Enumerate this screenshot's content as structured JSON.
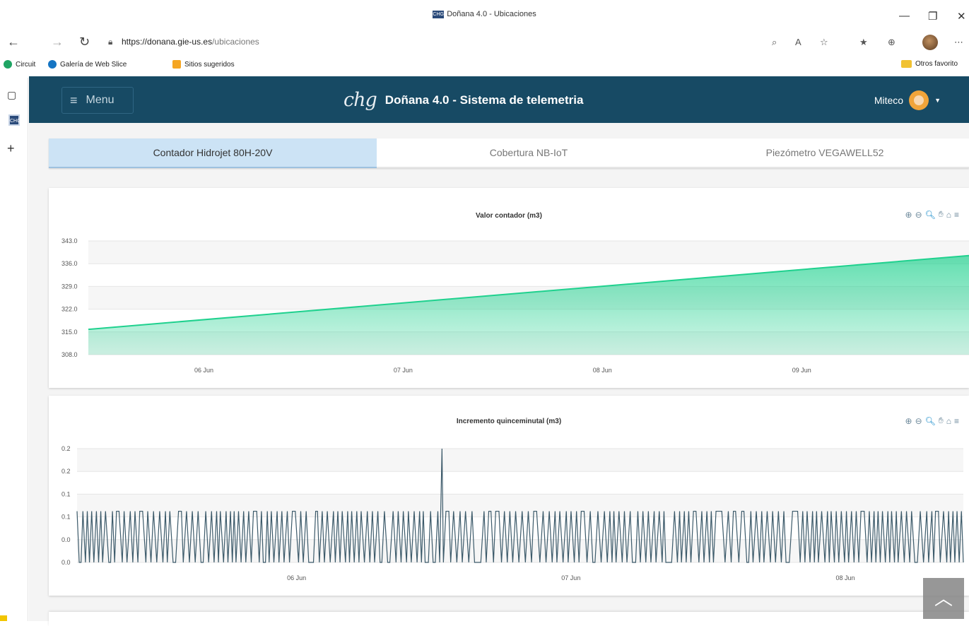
{
  "window": {
    "title": "Doñana 4.0 - Ubicaciones",
    "favicon_text": "CHG",
    "min": "—",
    "max": "❐",
    "close": "✕"
  },
  "browser": {
    "url_host": "https://donana.gie-us.es",
    "url_path": "/ubicaciones",
    "bookmarks": [
      {
        "label": "Circuit",
        "color": "#1fa463"
      },
      {
        "label": "Galería de Web Slice",
        "color": "#1575c3"
      },
      {
        "label": "Sitios sugeridos",
        "color": "#f5a623"
      }
    ],
    "other_favorites": "Otros favorito"
  },
  "rail": {
    "chg_text": "CHG",
    "add": "+"
  },
  "header": {
    "menu_label": "Menu",
    "logo_text": "chg",
    "title": "Doñana 4.0 - Sistema de telemetria",
    "user": "Miteco"
  },
  "tabs": [
    {
      "label": "Contador Hidrojet 80H-20V",
      "active": true
    },
    {
      "label": "Cobertura NB-IoT",
      "active": false
    },
    {
      "label": "Piezómetro VEGAWELL52",
      "active": false
    }
  ],
  "chart_data": [
    {
      "type": "area",
      "title": "Valor contador (m3)",
      "ylim": [
        308.0,
        343.0
      ],
      "yticks": [
        "343.0",
        "336.0",
        "329.0",
        "322.0",
        "315.0",
        "308.0"
      ],
      "xticks": [
        {
          "label": "06 Jun",
          "day": 6
        },
        {
          "label": "07 Jun",
          "day": 7
        },
        {
          "label": "08 Jun",
          "day": 8
        },
        {
          "label": "09 Jun",
          "day": 9
        }
      ],
      "x_start_day": 5.42,
      "x_end_day": 9.84,
      "series": [
        {
          "points": [
            [
              5.42,
              315.8
            ],
            [
              9.84,
              338.5
            ]
          ]
        }
      ],
      "color": "#1fd18e",
      "grid": true
    },
    {
      "type": "line",
      "title": "Incremento quinceminutal (m3)",
      "ylim": [
        0.0,
        0.2
      ],
      "yticks": [
        "0.2",
        "0.2",
        "0.1",
        "0.1",
        "0.0",
        "0.0"
      ],
      "xticks": [
        {
          "label": "06 Jun",
          "day": 6
        },
        {
          "label": "07 Jun",
          "day": 7
        },
        {
          "label": "08 Jun",
          "day": 8
        }
      ],
      "x_start_day": 5.2,
      "x_end_day": 8.43,
      "low": 0.0,
      "high": 0.09,
      "spike": {
        "day": 6.53,
        "value": 0.2
      },
      "color": "#3c5a6a",
      "grid": true
    }
  ],
  "scrolltop_icon": "chevron-up-icon"
}
